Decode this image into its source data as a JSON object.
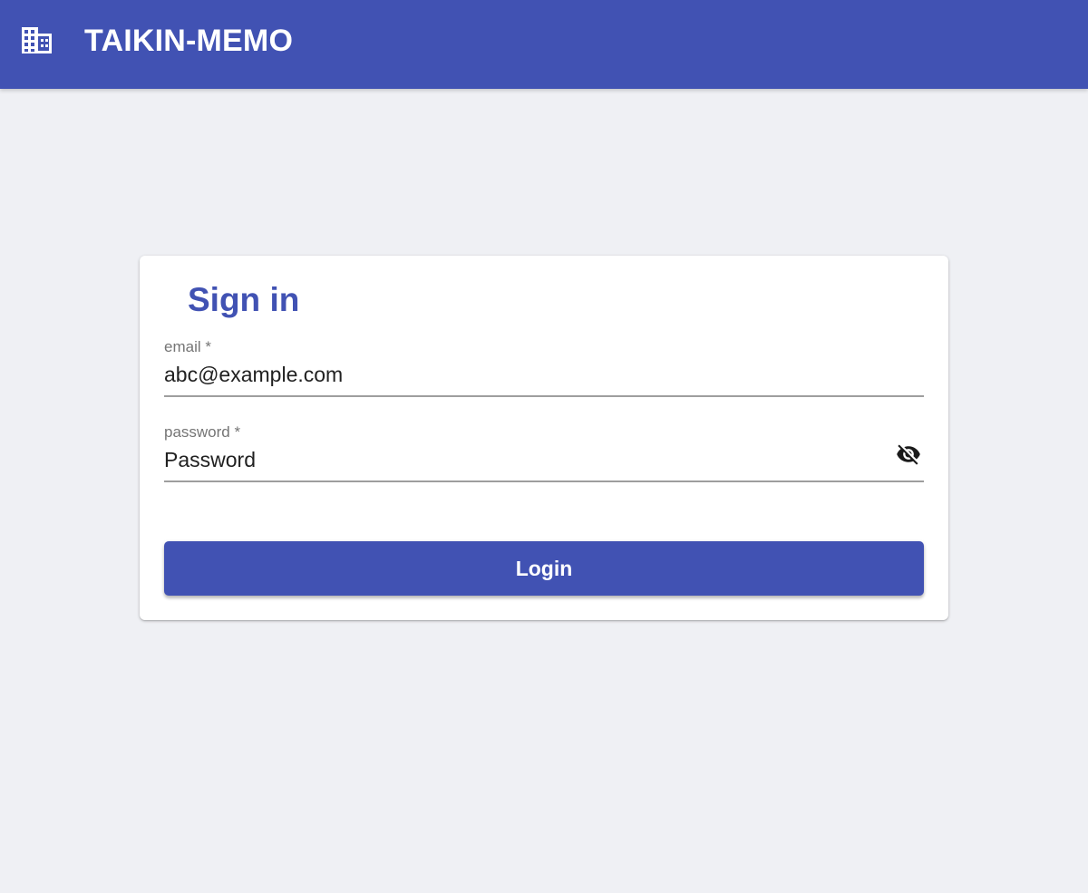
{
  "appbar": {
    "title": "TAIKIN-MEMO",
    "icon": "building-icon",
    "color": "#4152b3"
  },
  "signin": {
    "title": "Sign in",
    "email": {
      "label": "email *",
      "value": "abc@example.com"
    },
    "password": {
      "label": "password *",
      "value": "Password",
      "toggle_icon": "visibility-off-icon"
    },
    "login_label": "Login"
  },
  "colors": {
    "primary": "#4152b3",
    "background": "#eff0f4"
  }
}
